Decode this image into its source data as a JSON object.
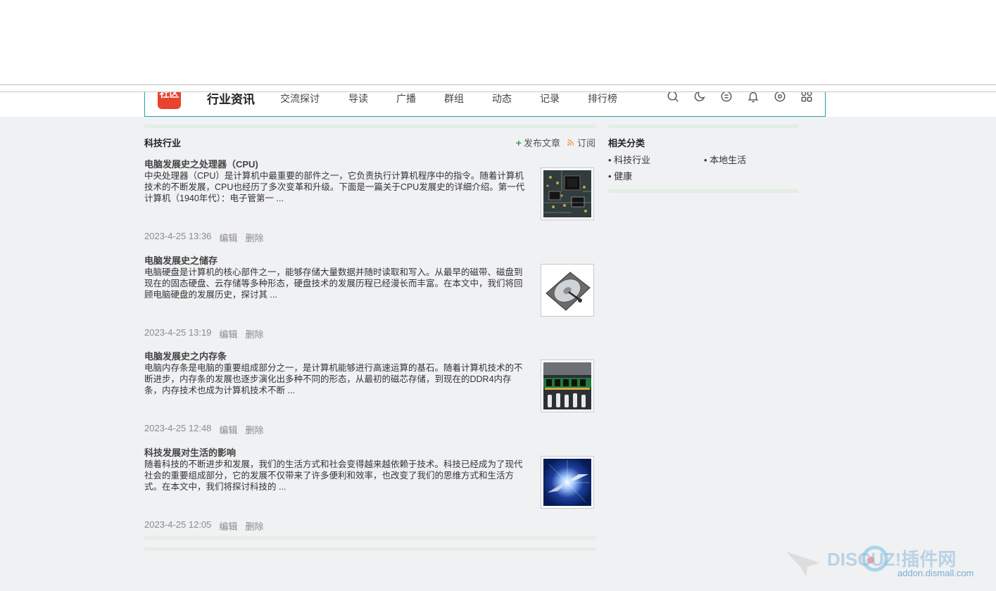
{
  "header": {
    "logo_text": "社区",
    "site_title": "行业资讯",
    "nav": [
      "交流探讨",
      "导读",
      "广播",
      "群组",
      "动态",
      "记录",
      "排行榜"
    ],
    "icons": [
      "search-icon",
      "moon-icon",
      "message-icon",
      "bell-icon",
      "settings-icon",
      "apps-icon"
    ]
  },
  "main": {
    "section_title": "科技行业",
    "post_label": "发布文章",
    "subscribe_label": "订阅",
    "edit_label": "编辑",
    "delete_label": "删除",
    "articles": [
      {
        "title": "电脑发展史之处理器（CPU)",
        "summary": "中央处理器（CPU）是计算机中最重要的部件之一，它负责执行计算机程序中的指令。随着计算机技术的不断发展，CPU也经历了多次变革和升级。下面是一篇关于CPU发展史的详细介绍。第一代计算机（1940年代）：电子管第一 ...",
        "time": "2023-4-25 13:36",
        "thumb": "cpu-board"
      },
      {
        "title": "电脑发展史之储存",
        "summary": "电脑硬盘是计算机的核心部件之一，能够存储大量数据并随时读取和写入。从最早的磁带、磁盘到现在的固态硬盘、云存储等多种形态，硬盘技术的发展历程已经漫长而丰富。在本文中，我们将回顾电脑硬盘的发展历史，探讨其 ...",
        "time": "2023-4-25 13:19",
        "thumb": "hard-disk"
      },
      {
        "title": "电脑发展史之内存条",
        "summary": "电脑内存条是电脑的重要组成部分之一，是计算机能够进行高速运算的基石。随着计算机技术的不断进步，内存条的发展也逐步演化出多种不同的形态，从最初的磁芯存储，到现在的DDR4内存条，内存技术也成为计算机技术不断 ...",
        "time": "2023-4-25 12:48",
        "thumb": "memory-stick"
      },
      {
        "title": "科技发展对生活的影响",
        "summary": "随着科技的不断进步和发展，我们的生活方式和社会变得越来越依赖于技术。科技已经成为了现代社会的重要组成部分，它的发展不仅带来了许多便利和效率，也改变了我们的思维方式和生活方式。在本文中，我们将探讨科技的 ...",
        "time": "2023-4-25 12:05",
        "thumb": "tech-hands"
      }
    ]
  },
  "sidebar": {
    "title": "相关分类",
    "categories": [
      "科技行业",
      "本地生活",
      "健康"
    ]
  },
  "watermark": {
    "brand": "DISCUZ!插件网",
    "url": "addon.dismall.com"
  },
  "colors": {
    "logo_red": "#e8432f",
    "header_border": "#2a9fa6",
    "green_bar": "#e2eee4",
    "page_bg": "#f0f1f3"
  }
}
